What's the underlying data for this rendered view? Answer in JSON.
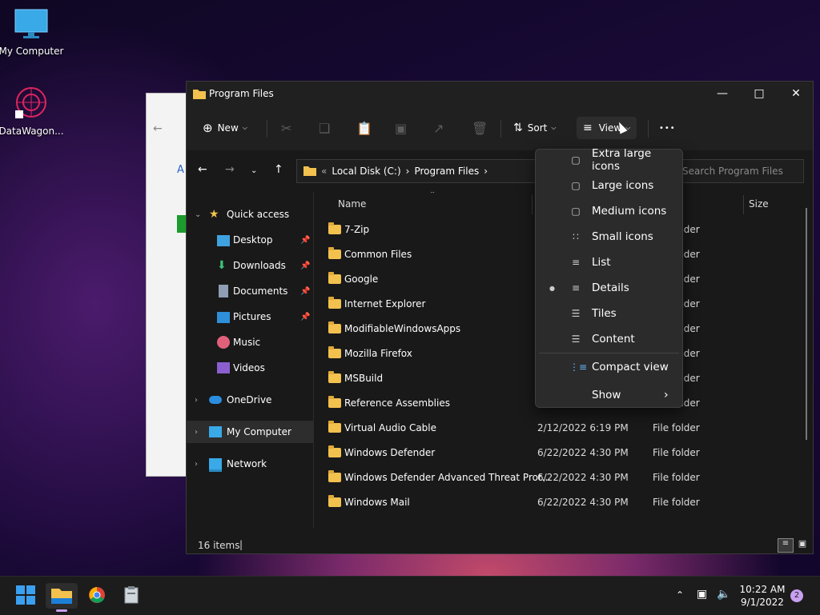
{
  "desktop": {
    "icons": [
      {
        "label": "My Computer",
        "icon": "monitor-icon"
      },
      {
        "label": "DataWagon...",
        "icon": "datawagon-icon"
      }
    ]
  },
  "window": {
    "title": "Program Files",
    "controls": {
      "minimize": "—",
      "maximize": "□",
      "close": "✕"
    }
  },
  "toolbar": {
    "new_label": "New",
    "sort_label": "Sort",
    "view_label": "View",
    "more_label": "•••"
  },
  "address": {
    "overflow": "«",
    "crumbs": [
      "Local Disk (C:)",
      "Program Files"
    ],
    "separator": "›",
    "search_placeholder": "Search Program Files"
  },
  "nav": {
    "quick_access": "Quick access",
    "pinned": [
      "Desktop",
      "Downloads",
      "Documents",
      "Pictures"
    ],
    "unpinned": [
      "Music",
      "Videos"
    ],
    "onedrive": "OneDrive",
    "my_computer": "My Computer",
    "network": "Network"
  },
  "columns": {
    "name": "Name",
    "size": "Size"
  },
  "files": [
    {
      "name": "7-Zip",
      "date": "",
      "type": "File folder"
    },
    {
      "name": "Common Files",
      "date": "",
      "type": "File folder"
    },
    {
      "name": "Google",
      "date": "",
      "type": "File folder"
    },
    {
      "name": "Internet Explorer",
      "date": "",
      "type": "File folder"
    },
    {
      "name": "ModifiableWindowsApps",
      "date": "",
      "type": "File folder"
    },
    {
      "name": "Mozilla Firefox",
      "date": "",
      "type": "File folder"
    },
    {
      "name": "MSBuild",
      "date": "",
      "type": "File folder"
    },
    {
      "name": "Reference Assemblies",
      "date": "",
      "type": "File folder"
    },
    {
      "name": "Virtual Audio Cable",
      "date": "2/12/2022 6:19 PM",
      "type": "File folder"
    },
    {
      "name": "Windows Defender",
      "date": "6/22/2022 4:30 PM",
      "type": "File folder"
    },
    {
      "name": "Windows Defender Advanced Threat Prot...",
      "date": "6/22/2022 4:30 PM",
      "type": "File folder"
    },
    {
      "name": "Windows Mail",
      "date": "6/22/2022 4:30 PM",
      "type": "File folder"
    }
  ],
  "status": {
    "count": "16 items"
  },
  "view_menu": {
    "items": [
      {
        "label": "Extra large icons",
        "icon": "extra-large-icons-icon"
      },
      {
        "label": "Large icons",
        "icon": "large-icons-icon"
      },
      {
        "label": "Medium icons",
        "icon": "medium-icons-icon"
      },
      {
        "label": "Small icons",
        "icon": "small-icons-icon"
      },
      {
        "label": "List",
        "icon": "list-icon"
      },
      {
        "label": "Details",
        "icon": "details-icon",
        "selected": true
      },
      {
        "label": "Tiles",
        "icon": "tiles-icon"
      },
      {
        "label": "Content",
        "icon": "content-icon"
      }
    ],
    "compact": "Compact view",
    "show": "Show"
  },
  "taskbar": {
    "time": "10:22 AM",
    "date": "9/1/2022",
    "notifications": "2"
  },
  "colors": {
    "accent": "#0078d4",
    "folder": "#f2c14e"
  }
}
